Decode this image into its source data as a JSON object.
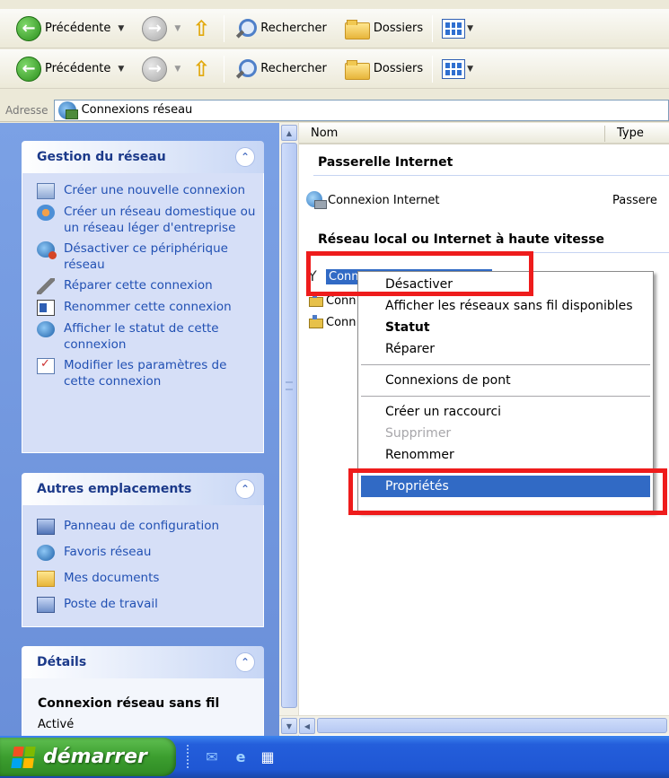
{
  "toolbar": {
    "back_label": "Précédente",
    "search_label": "Rechercher",
    "folders_label": "Dossiers"
  },
  "address": {
    "label": "Adresse",
    "value": "Connexions réseau"
  },
  "network_tasks": {
    "title": "Gestion du réseau",
    "items": [
      {
        "label": "Créer une nouvelle connexion",
        "icon": "new-connection-icon"
      },
      {
        "label": "Créer un réseau domestique ou un réseau léger d'entreprise",
        "icon": "home-network-icon"
      },
      {
        "label": "Désactiver ce périphérique réseau",
        "icon": "disable-device-icon"
      },
      {
        "label": "Réparer cette connexion",
        "icon": "repair-icon"
      },
      {
        "label": "Renommer cette connexion",
        "icon": "rename-icon"
      },
      {
        "label": "Afficher le statut de cette connexion",
        "icon": "status-icon"
      },
      {
        "label": "Modifier les paramètres de cette connexion",
        "icon": "settings-icon"
      }
    ]
  },
  "other_places": {
    "title": "Autres emplacements",
    "items": [
      {
        "label": "Panneau de configuration",
        "icon": "control-panel-icon"
      },
      {
        "label": "Favoris réseau",
        "icon": "network-favorites-icon"
      },
      {
        "label": "Mes documents",
        "icon": "documents-icon"
      },
      {
        "label": "Poste de travail",
        "icon": "computer-icon"
      }
    ]
  },
  "details": {
    "title": "Détails",
    "name": "Connexion réseau sans fil",
    "state": "Activé"
  },
  "list": {
    "col_name": "Nom",
    "col_type": "Type",
    "group1": "Passerelle Internet",
    "group2": "Réseau local ou Internet à haute vitesse",
    "inet_item": {
      "name": "Connexion Internet",
      "type": "Passere"
    },
    "wifi_item": "Conn",
    "lan_item_1": "Conn",
    "lan_item_2": "Conn"
  },
  "context_menu": {
    "items": [
      "Désactiver",
      "Afficher les réseaux sans fil disponibles",
      "Statut",
      "Réparer",
      "Connexions de pont",
      "Créer un raccourci",
      "Supprimer",
      "Renommer",
      "Propriétés"
    ]
  },
  "taskbar": {
    "start_label": "démarrer"
  },
  "colors": {
    "selection": "#316ac5",
    "highlight_box": "#ee1c1c",
    "start_green": "#3c9e2f"
  }
}
